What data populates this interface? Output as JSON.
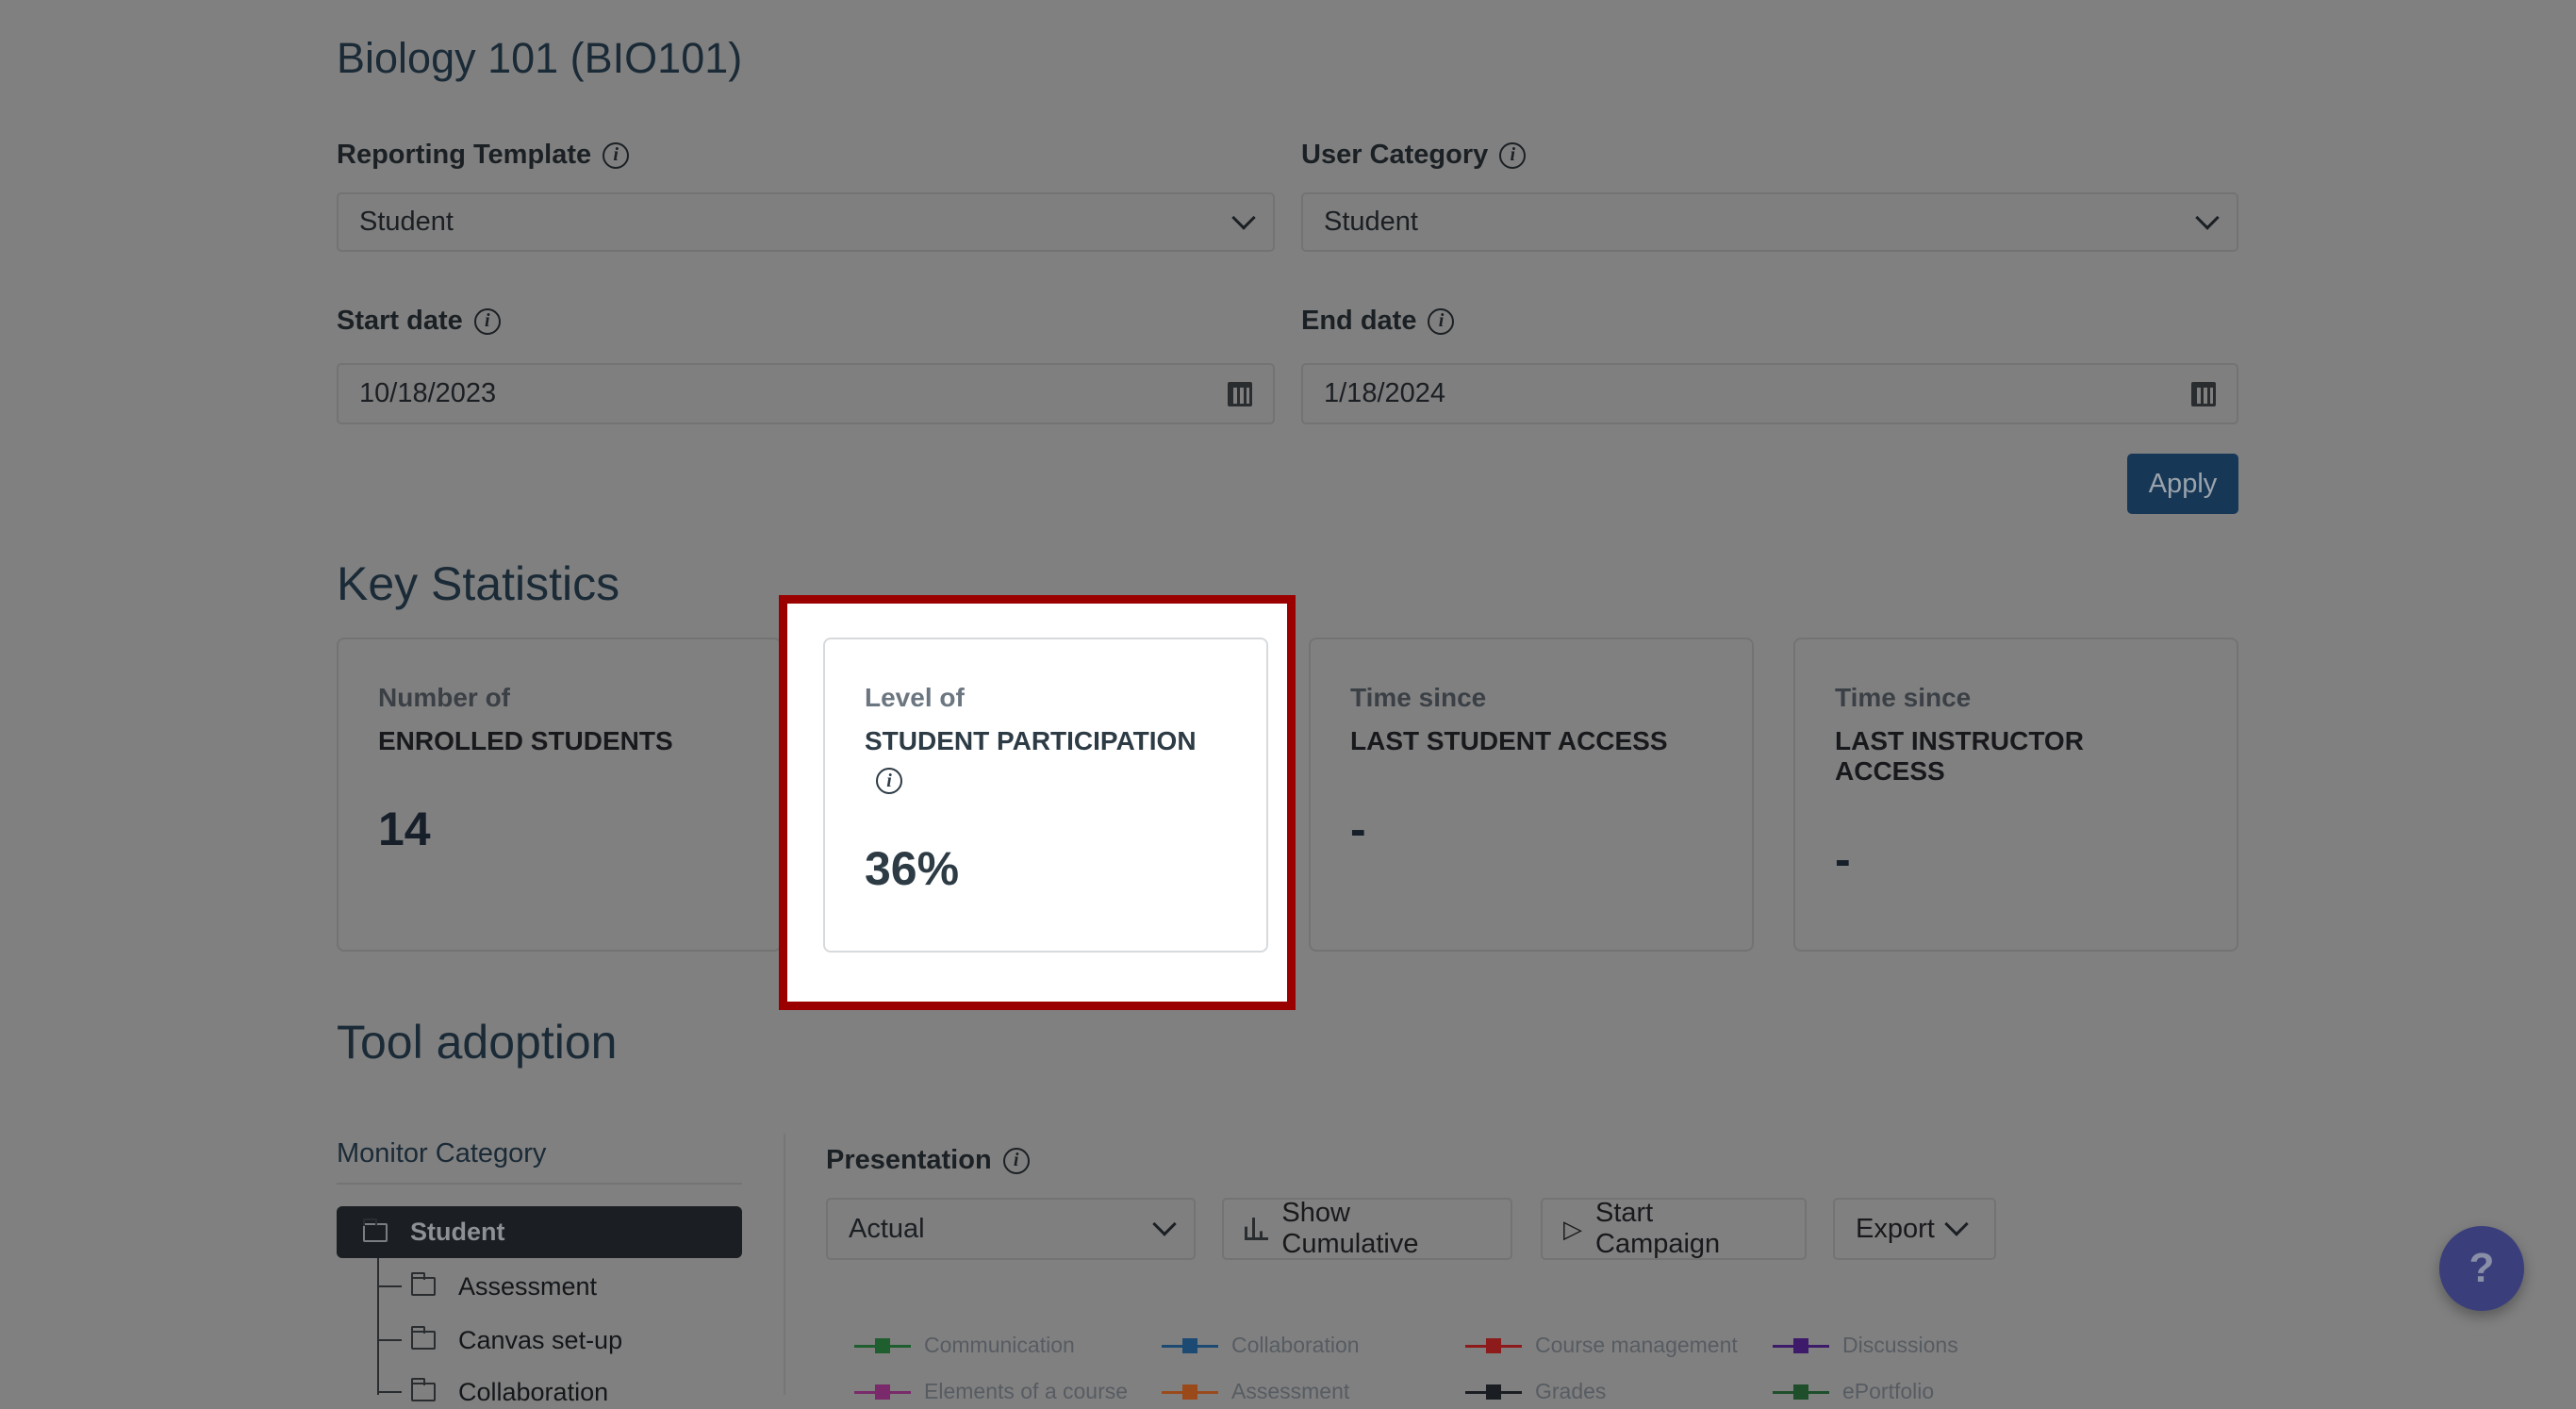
{
  "page_title": "Biology 101 (BIO101)",
  "filters": {
    "reporting_template": {
      "label": "Reporting Template",
      "value": "Student"
    },
    "user_category": {
      "label": "User Category",
      "value": "Student"
    },
    "start_date": {
      "label": "Start date",
      "value": "10/18/2023"
    },
    "end_date": {
      "label": "End date",
      "value": "1/18/2024"
    },
    "apply_label": "Apply"
  },
  "key_statistics": {
    "heading": "Key Statistics",
    "cards": [
      {
        "sub": "Number of",
        "caption": "ENROLLED STUDENTS",
        "value": "14"
      },
      {
        "sub": "Level of",
        "caption": "STUDENT PARTICIPATION",
        "value": "36%"
      },
      {
        "sub": "Time since",
        "caption": "LAST STUDENT ACCESS",
        "value": "-"
      },
      {
        "sub": "Time since",
        "caption": "LAST INSTRUCTOR ACCESS",
        "value": "-"
      }
    ]
  },
  "tool_adoption": {
    "heading": "Tool adoption",
    "monitor_category": {
      "label": "Monitor Category",
      "selected": "Student",
      "items": [
        "Assessment",
        "Canvas set-up",
        "Collaboration"
      ]
    },
    "presentation": {
      "label": "Presentation",
      "value": "Actual"
    },
    "buttons": {
      "cumulative": "Show Cumulative",
      "campaign": "Start Campaign",
      "export": "Export"
    },
    "legend": [
      {
        "name": "Communication",
        "color": "#1f5f2f"
      },
      {
        "name": "Collaboration",
        "color": "#1d4a73"
      },
      {
        "name": "Course management",
        "color": "#8e1b1b"
      },
      {
        "name": "Discussions",
        "color": "#3e1a6b"
      },
      {
        "name": "Elements of a course",
        "color": "#7a2a6a"
      },
      {
        "name": "Assessment",
        "color": "#9a4a1a"
      },
      {
        "name": "Grades",
        "color": "#1a1e22"
      },
      {
        "name": "ePortfolio",
        "color": "#1e4f2a"
      }
    ]
  },
  "colors": {
    "highlight": "#9a0000",
    "apply": "#173756",
    "help": "#3a3f7c"
  }
}
